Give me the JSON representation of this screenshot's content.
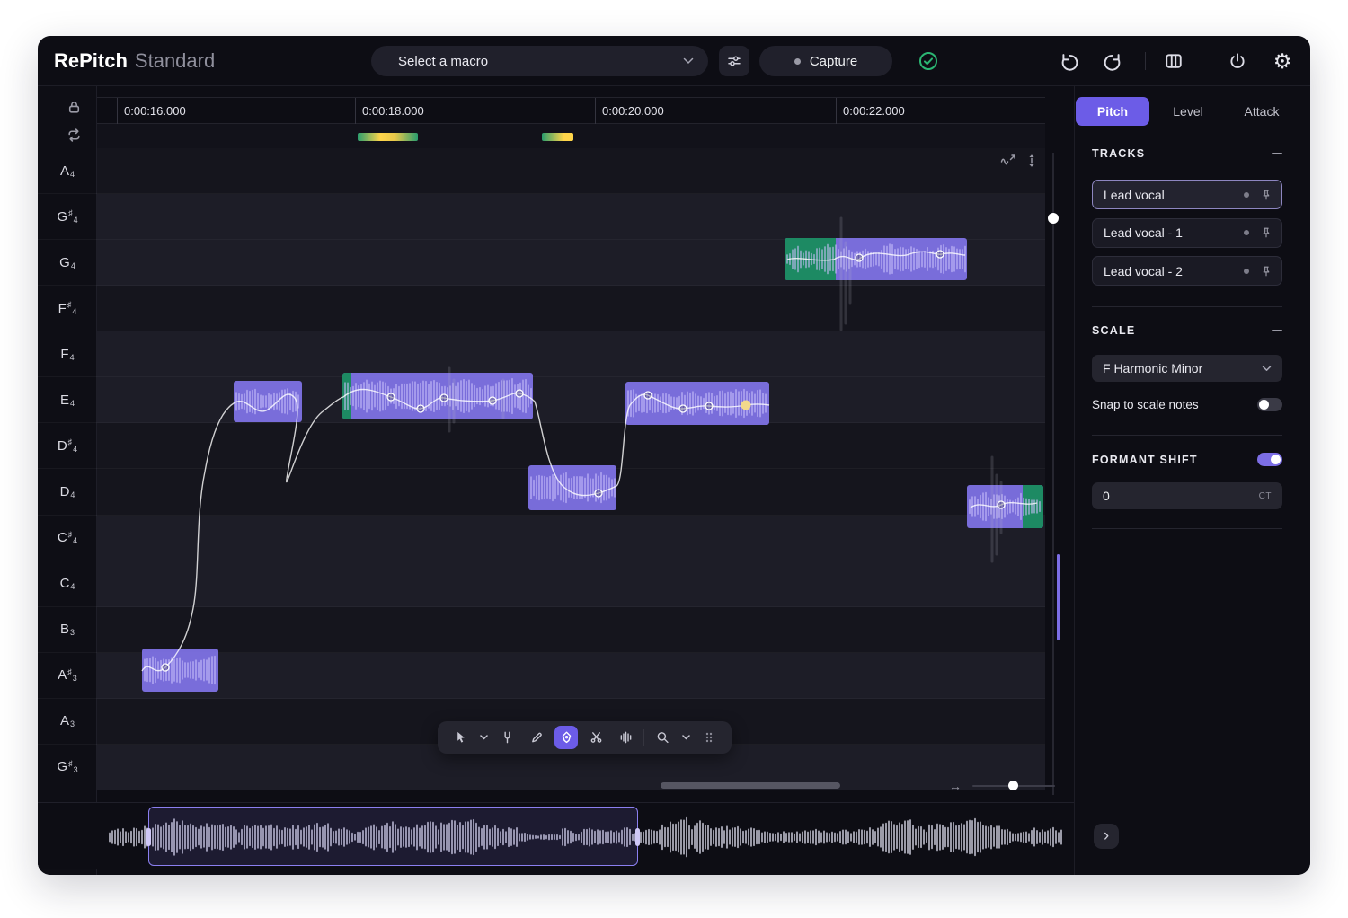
{
  "app": {
    "brand": "RePitch",
    "edition": "Standard"
  },
  "topbar": {
    "macro_placeholder": "Select a macro",
    "capture_label": "Capture"
  },
  "timeline": {
    "ticks": [
      "0:00:16.000",
      "0:00:18.000",
      "0:00:20.000",
      "0:00:22.000"
    ]
  },
  "piano": {
    "notes": [
      {
        "letter": "A",
        "sharp": false,
        "octave": "4",
        "in_scale": false
      },
      {
        "letter": "G",
        "sharp": true,
        "octave": "4",
        "in_scale": true
      },
      {
        "letter": "G",
        "sharp": false,
        "octave": "4",
        "in_scale": true
      },
      {
        "letter": "F",
        "sharp": true,
        "octave": "4",
        "in_scale": false
      },
      {
        "letter": "F",
        "sharp": false,
        "octave": "4",
        "in_scale": true
      },
      {
        "letter": "E",
        "sharp": false,
        "octave": "4",
        "in_scale": true
      },
      {
        "letter": "D",
        "sharp": true,
        "octave": "4",
        "in_scale": false
      },
      {
        "letter": "D",
        "sharp": false,
        "octave": "4",
        "in_scale": false
      },
      {
        "letter": "C",
        "sharp": true,
        "octave": "4",
        "in_scale": true
      },
      {
        "letter": "C",
        "sharp": false,
        "octave": "4",
        "in_scale": true
      },
      {
        "letter": "B",
        "sharp": false,
        "octave": "3",
        "in_scale": false
      },
      {
        "letter": "A",
        "sharp": true,
        "octave": "3",
        "in_scale": true
      },
      {
        "letter": "A",
        "sharp": false,
        "octave": "3",
        "in_scale": false
      },
      {
        "letter": "G",
        "sharp": true,
        "octave": "3",
        "in_scale": true
      }
    ]
  },
  "panel": {
    "tabs": [
      {
        "label": "Pitch",
        "active": true
      },
      {
        "label": "Level",
        "active": false
      },
      {
        "label": "Attack",
        "active": false
      }
    ],
    "tracks": {
      "title": "TRACKS",
      "items": [
        {
          "label": "Lead vocal",
          "selected": true
        },
        {
          "label": "Lead vocal - 1",
          "selected": false
        },
        {
          "label": "Lead vocal - 2",
          "selected": false
        }
      ]
    },
    "scale": {
      "title": "SCALE",
      "value": "F Harmonic Minor",
      "snap_label": "Snap to scale notes",
      "snap_on": false
    },
    "formant": {
      "title": "FORMANT SHIFT",
      "enabled": true,
      "value": "0",
      "unit": "CT"
    }
  },
  "colors": {
    "accent": "#6c5ce7",
    "clip_purple": "#8174e9",
    "clip_green": "#1d8a63",
    "capture_ok": "#2bb673",
    "marker_yellow": "#ffd54a"
  }
}
